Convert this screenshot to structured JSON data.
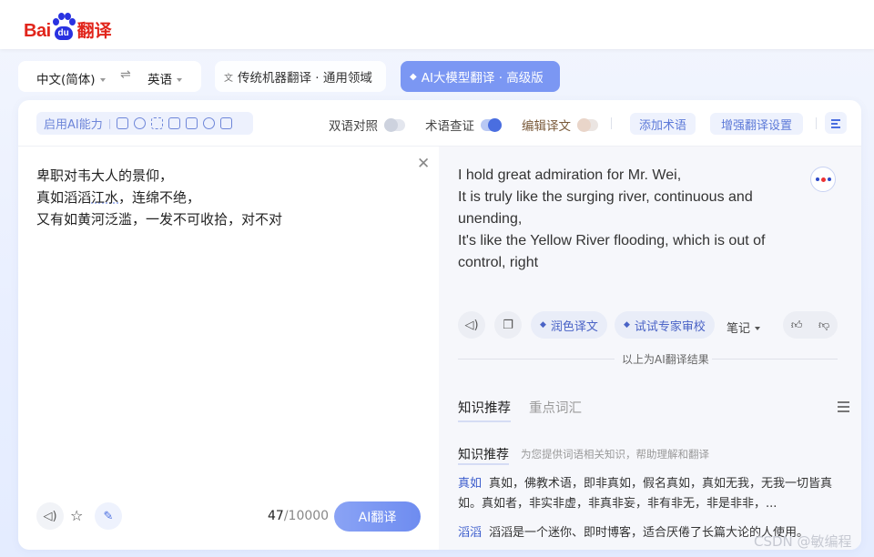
{
  "header": {
    "logo_bai": "Bai",
    "logo_du": "du",
    "logo_fanyi": "翻译"
  },
  "lang": {
    "source": "中文(简体)",
    "swap_icon": "⇌",
    "target": "英语"
  },
  "modes": {
    "traditional": "传统机器翻译 · 通用领域",
    "ai": "AI大模型翻译 · 高级版"
  },
  "toolbar": {
    "ai_capability": "启用AI能力",
    "bilingual": "双语对照",
    "term_check": "术语查证",
    "edit_translation": "编辑译文",
    "add_term": "添加术语",
    "enhance_settings": "增强翻译设置"
  },
  "source": {
    "lines": [
      "卑职对韦大人的景仰，",
      "真如滔滔",
      "江水",
      "，连绵不绝，",
      "又有如黄河泛滥，一发不可收拾，对不对"
    ],
    "count_current": "47",
    "count_max": "/10000",
    "translate_button": "AI翻译"
  },
  "target": {
    "lines": [
      "I hold great admiration for Mr. Wei,",
      "It is truly like the surging river, continuous and unending,",
      "It's like the Yellow River flooding, which is out of control, right"
    ],
    "polish": "润色译文",
    "expert_review": "试试专家审校",
    "notes": "笔记",
    "ai_result_note": "以上为AI翻译结果"
  },
  "knowledge": {
    "tabs": [
      "知识推荐",
      "重点词汇"
    ],
    "heading": "知识推荐",
    "subheading": "为您提供词语相关知识，帮助理解和翻译",
    "items": [
      {
        "term": "真如",
        "text": "真如，佛教术语，即非真如，假名真如，真如无我，无我一切皆真如。真如者，非实非虚，非真非妄，非有非无，非是非非，..."
      },
      {
        "term": "滔滔",
        "text": "滔滔是一个迷你、即时博客，适合厌倦了长篇大论的人使用。"
      }
    ]
  },
  "watermark": "CSDN @敏编程",
  "colors": {
    "brand_red": "#e1251b",
    "brand_blue": "#2932e1",
    "accent": "#4a6ee0"
  }
}
